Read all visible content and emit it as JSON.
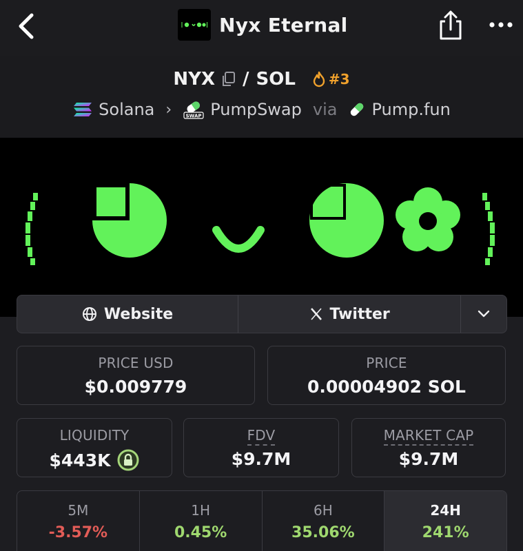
{
  "header": {
    "title": "Nyx Eternal"
  },
  "pair": {
    "base": "NYX",
    "slash": "/",
    "quote": "SOL",
    "rank": "#3",
    "chain": "Solana",
    "dex": "PumpSwap",
    "via_label": "via",
    "launchpad": "Pump.fun"
  },
  "links": {
    "website": "Website",
    "twitter": "Twitter"
  },
  "stats": {
    "price_usd": {
      "label": "PRICE USD",
      "value": "$0.009779"
    },
    "price": {
      "label": "PRICE",
      "value": "0.00004902 SOL"
    },
    "liquidity": {
      "label": "LIQUIDITY",
      "value": "$443K"
    },
    "fdv": {
      "label": "FDV",
      "value": "$9.7M"
    },
    "market_cap": {
      "label": "MARKET CAP",
      "value": "$9.7M"
    }
  },
  "timeframes": [
    {
      "label": "5M",
      "change": "-3.57%"
    },
    {
      "label": "1H",
      "change": "0.45%"
    },
    {
      "label": "6H",
      "change": "35.06%"
    },
    {
      "label": "24H",
      "change": "241%"
    }
  ],
  "colors": {
    "negative": "#e25c57",
    "positive": "#9fd86f",
    "banner_green": "#62f25a",
    "rank_orange": "#f0a12c"
  },
  "icons": {
    "back": "chevron-left-icon",
    "share": "share-icon",
    "more": "more-horizontal-icon",
    "copy": "copy-icon",
    "rank": "flame-icon",
    "website": "globe-icon",
    "twitter": "x-logo-icon",
    "expand": "chevron-down-icon",
    "lock": "lock-icon"
  }
}
